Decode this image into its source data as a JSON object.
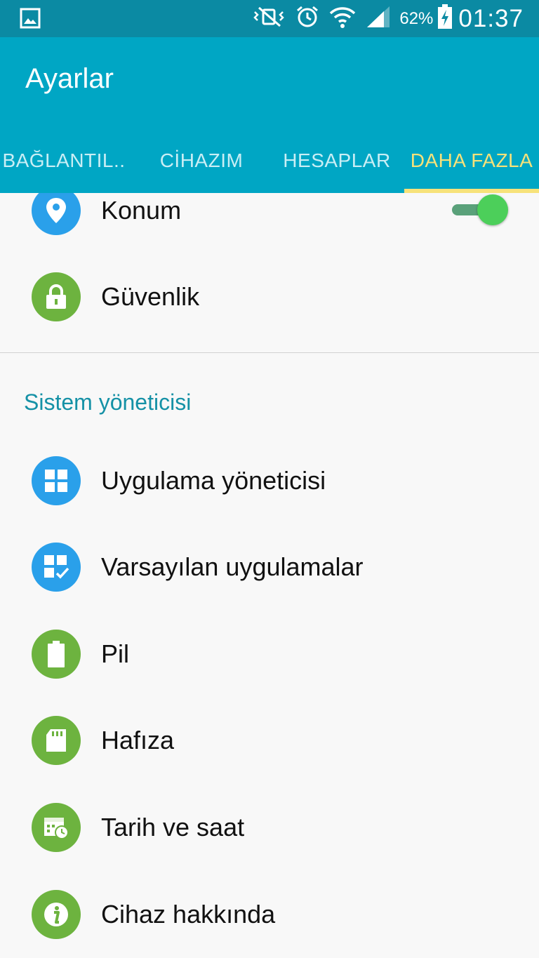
{
  "status_bar": {
    "battery_percent": "62%",
    "time": "01:37",
    "icons": [
      "gallery-icon",
      "vibrate-mute-icon",
      "alarm-icon",
      "wifi-icon",
      "signal-icon",
      "battery-charging-icon"
    ]
  },
  "app_bar": {
    "title": "Ayarlar",
    "tabs": [
      {
        "label": "BAĞLANTIL.."
      },
      {
        "label": "CİHAZIM"
      },
      {
        "label": "HESAPLAR"
      },
      {
        "label": "DAHA FAZLA"
      }
    ],
    "active_tab": "DAHA FAZLA"
  },
  "settings": {
    "items_top": [
      {
        "label": "Konum",
        "icon": "location-pin-icon",
        "color": "#2aa0ea",
        "toggle_on": true
      },
      {
        "label": "Güvenlik",
        "icon": "lock-icon",
        "color": "#6db33f"
      }
    ],
    "section_title": "Sistem yöneticisi",
    "items": [
      {
        "label": "Uygulama yöneticisi",
        "icon": "app-grid-icon",
        "color": "#2aa0ea"
      },
      {
        "label": "Varsayılan uygulamalar",
        "icon": "default-apps-icon",
        "color": "#2aa0ea"
      },
      {
        "label": "Pil",
        "icon": "battery-icon",
        "color": "#6db33f"
      },
      {
        "label": "Hafıza",
        "icon": "sd-card-icon",
        "color": "#6db33f"
      },
      {
        "label": "Tarih ve saat",
        "icon": "calendar-clock-icon",
        "color": "#6db33f"
      },
      {
        "label": "Cihaz hakkında",
        "icon": "info-icon",
        "color": "#6db33f"
      }
    ]
  },
  "colors": {
    "status_bar": "#0b8aa3",
    "app_bar": "#00a6c4",
    "active_tab": "#f7e27a",
    "section_header": "#1591a6",
    "toggle_thumb": "#4ccf5a"
  }
}
